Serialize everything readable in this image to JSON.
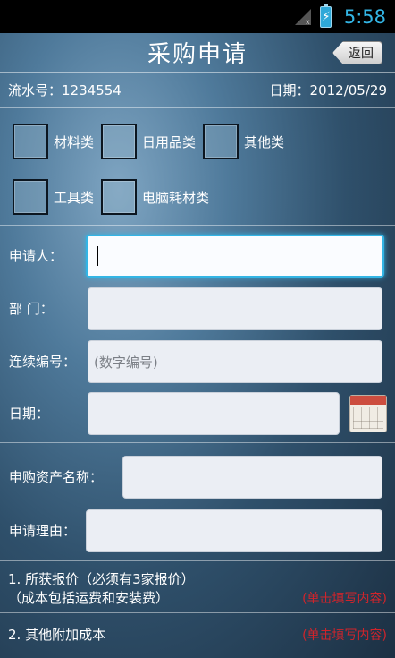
{
  "status_bar": {
    "time": "5:58",
    "signal_icon": "signal-icon",
    "battery_icon": "battery-charging-icon",
    "battery_glyph": "⚡"
  },
  "header": {
    "title": "采购申请",
    "back_label": "返回"
  },
  "info": {
    "serial": "流水号：1234554",
    "date": "日期：2012/05/29"
  },
  "categories": {
    "row1": [
      "材料类",
      "日用品类",
      "其他类"
    ],
    "row2": [
      "工具类",
      "电脑耗材类"
    ]
  },
  "form": {
    "applicant_label": "申请人：",
    "applicant_value": "",
    "department_label": "部 门：",
    "department_value": "",
    "serial_no_label": "连续编号：",
    "serial_no_placeholder": "(数字编号)",
    "date_label": "日期：",
    "date_value": "",
    "calendar_icon": "calendar-icon"
  },
  "asset": {
    "name_label": "申购资产名称：",
    "name_value": "",
    "reason_label": "申请理由：",
    "reason_value": ""
  },
  "quotes": {
    "item1_line1": "1. 所获报价（必须有3家报价）",
    "item1_line2": "（成本包括运费和安装费）",
    "item1_hint": "(单击填写内容)",
    "item2_label": "2. 其他附加成本",
    "item2_hint": "(单击填写内容)"
  },
  "colors": {
    "accent": "#33b5e5",
    "hint_red": "#d0242b"
  }
}
